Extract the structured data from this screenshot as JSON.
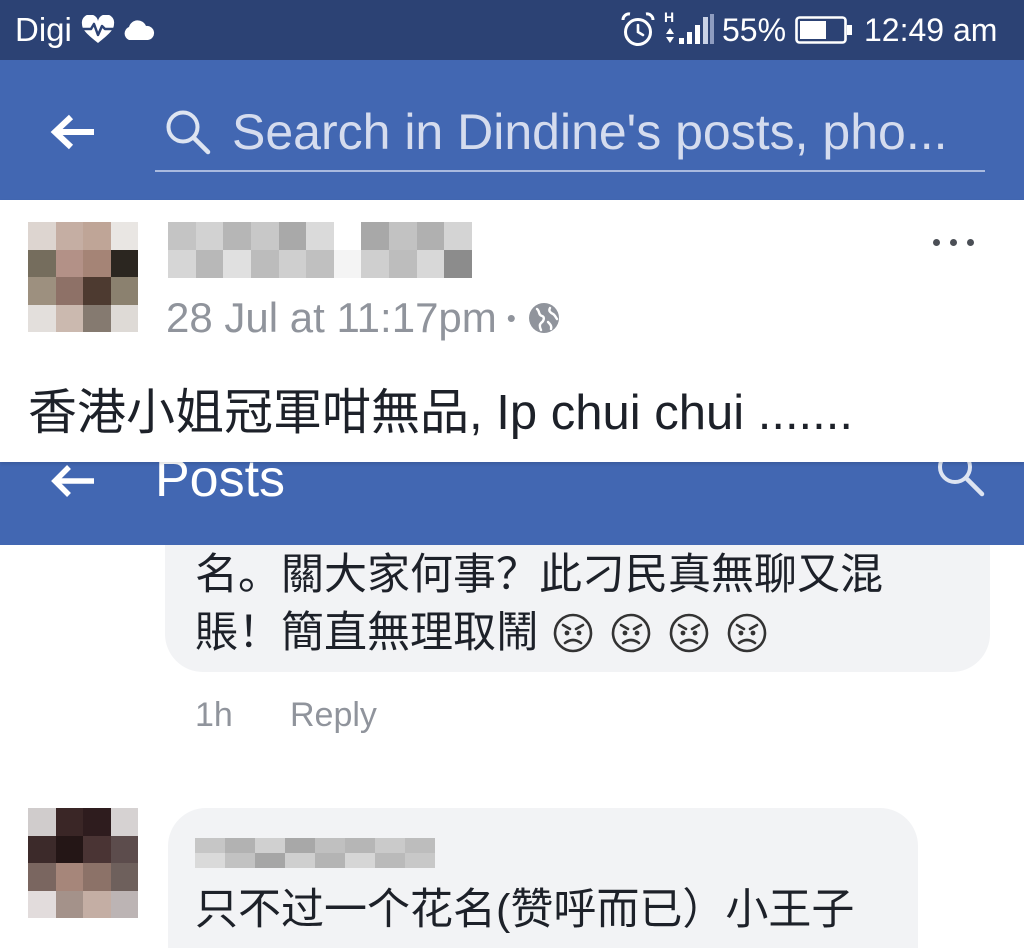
{
  "status_bar": {
    "carrier": "Digi",
    "network_type": "H",
    "battery": "55%",
    "time": "12:49 am",
    "icons": [
      "heart-pulse-icon",
      "cloud-icon",
      "alarm-icon",
      "signal-icon",
      "battery-icon"
    ]
  },
  "search_header": {
    "placeholder": "Search in Dindine's posts, pho...",
    "icons": [
      "back-arrow-icon",
      "search-icon"
    ]
  },
  "post": {
    "timestamp": "28 Jul at 11:17pm",
    "separator": "•",
    "body": "香港小姐冠軍咁無品, Ip chui chui .......",
    "icons": [
      "globe-icon",
      "more-options-icon"
    ]
  },
  "posts_header": {
    "title": "Posts",
    "icons": [
      "back-arrow-icon",
      "search-icon"
    ]
  },
  "comments": [
    {
      "lines": [
        "名。關大家何事？此刁民真無聊又混",
        "賬！簡直無理取鬧"
      ],
      "emoji": [
        "angry-face-icon",
        "angry-face-icon",
        "angry-face-icon",
        "angry-face-icon"
      ],
      "time": "1h",
      "reply_label": "Reply"
    },
    {
      "body": "只不过一个花名(赞呼而已）小王子"
    }
  ],
  "colors": {
    "status_bar": "#2c4274",
    "header": "#4267b2",
    "comment_bubble": "#f2f3f5",
    "meta_text": "#90949c",
    "body_text": "#1d2129"
  }
}
